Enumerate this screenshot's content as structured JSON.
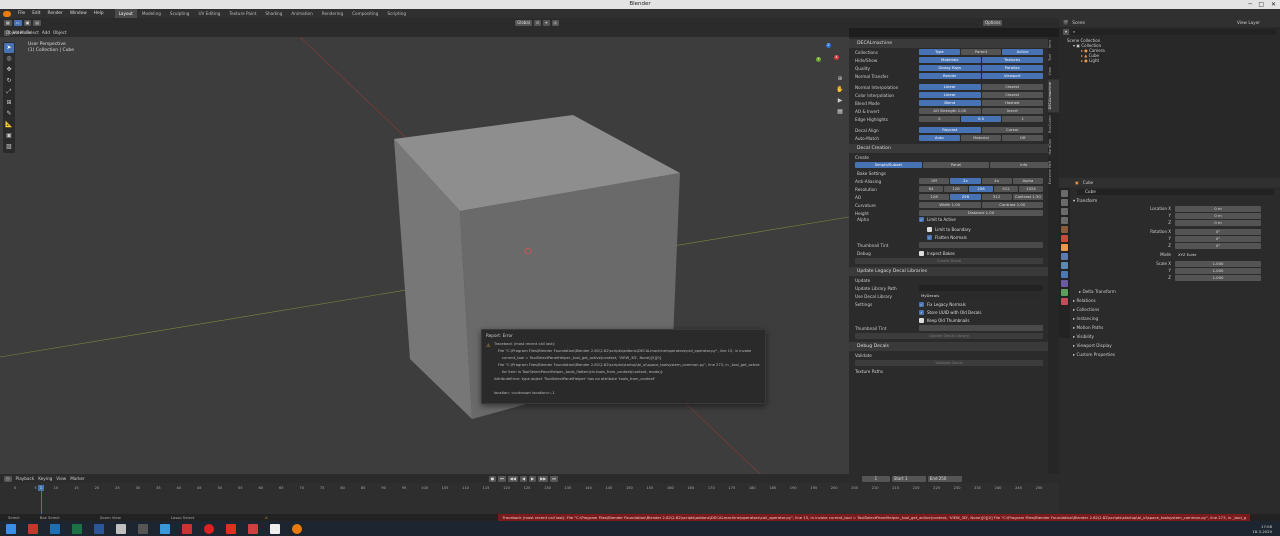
{
  "window": {
    "title": "Blender",
    "minimize": "─",
    "maximize": "□",
    "close": "✕"
  },
  "menu": {
    "items": [
      "File",
      "Edit",
      "Render",
      "Window",
      "Help"
    ],
    "workspaces": [
      "Layout",
      "Modeling",
      "Sculpting",
      "UV Editing",
      "Texture Paint",
      "Shading",
      "Animation",
      "Rendering",
      "Compositing",
      "Scripting"
    ],
    "active_workspace": "Layout"
  },
  "viewport": {
    "mode": "Object Mode",
    "menus": [
      "View",
      "Select",
      "Add",
      "Object"
    ],
    "orientation": "Global",
    "options": "Options",
    "overlay_title": "User Perspective",
    "overlay_sub": "(1) Collection | Cube",
    "gizmo_x": "X",
    "gizmo_y": "Y",
    "gizmo_z": "Z"
  },
  "npanel": {
    "header": "DECALmachine",
    "rows1": [
      {
        "label": "Collections",
        "buttons": [
          "Type",
          "Parent",
          "Active"
        ],
        "on": [
          0,
          2
        ]
      },
      {
        "label": "Hide/Show",
        "buttons": [
          "Materials",
          "Textures"
        ],
        "on": [
          0,
          1
        ]
      },
      {
        "label": "Quality",
        "buttons": [
          "Glossy Rays",
          "Parallax"
        ],
        "on": [
          0,
          1
        ]
      },
      {
        "label": "Normal Transfer",
        "buttons": [
          "Render",
          "Viewport"
        ],
        "on": [
          0,
          1
        ]
      }
    ],
    "rows2": [
      {
        "label": "Normal Interpolation",
        "buttons": [
          "Linear",
          "Closest"
        ],
        "on": [
          0
        ]
      },
      {
        "label": "Color Interpolation",
        "buttons": [
          "Linear",
          "Closest"
        ],
        "on": [
          0
        ]
      },
      {
        "label": "Blend Mode",
        "buttons": [
          "Blend",
          "Hashed"
        ],
        "on": [
          0
        ]
      },
      {
        "label": "AO & Invert",
        "buttons": [
          "AO Strength  1.00",
          "Invert"
        ],
        "on": []
      },
      {
        "label": "Edge Highlights",
        "buttons": [
          "0",
          "0.5",
          "1"
        ],
        "on": [
          1
        ]
      }
    ],
    "rows3": [
      {
        "label": "Decal Align",
        "buttons": [
          "Raycast",
          "Cursor"
        ],
        "on": [
          0
        ]
      },
      {
        "label": "Auto-Match",
        "buttons": [
          "Auto",
          "Material",
          "Off"
        ],
        "on": [
          0
        ]
      }
    ],
    "decal_creation": {
      "header": "Decal Creation",
      "create_label": "Create",
      "create_buttons": [
        "Simple/Subset",
        "Panel",
        "Info"
      ],
      "bake_settings": "Bake Settings",
      "rows": [
        {
          "label": "Anti-Aliasing",
          "buttons": [
            "Off",
            "2x",
            "4x",
            "Alpha"
          ],
          "on": [
            1
          ]
        },
        {
          "label": "Resolution",
          "buttons": [
            "64",
            "128",
            "256",
            "512",
            "1024"
          ],
          "on": [
            2
          ]
        },
        {
          "label": "AO",
          "buttons": [
            "128",
            "256",
            "512",
            "Contrast   1.50"
          ],
          "on": [
            1
          ]
        },
        {
          "label": "Curvature",
          "buttons": [
            "Width   1.00",
            "Contrast   1.00"
          ],
          "on": []
        },
        {
          "label": "Height",
          "buttons": [
            "Distance   1.00"
          ],
          "on": []
        }
      ],
      "alpha_label": "Alpha",
      "alpha_opts": [
        "Limit to Active",
        "Limit to Boundary",
        "Flatten Normals"
      ],
      "thumb_label": "Thumbnail Tint",
      "debug_label": "Debug",
      "debug_opt": "Inspect Bakes",
      "create_decal": "Create Decal"
    },
    "legacy": {
      "header": "Update Legacy Decal Libraries",
      "update": "Update",
      "path_label": "Update Library Path",
      "use_lib_label": "Use Decal Library",
      "use_lib_val": "MyDecals",
      "settings": "Settings",
      "opts": [
        "Fix Legacy Normals",
        "Store UUID with Old Decals",
        "Keep Old Thumbnails"
      ],
      "thumb": "Thumbnail Tint",
      "btn": "Update Decal Library"
    },
    "debug": {
      "header": "Debug Decals",
      "validate": "Validate",
      "btn": "Validate Decal",
      "paths": "Texture Paths"
    },
    "tabs": [
      "Item",
      "Tool",
      "View",
      "DECALmachine",
      "BoxCutter",
      "HardOps",
      "Extreme PBR"
    ]
  },
  "outliner": {
    "scene": "Scene",
    "view_layer": "View Layer",
    "root": "Scene Collection",
    "items": [
      "Collection",
      "Camera",
      "Cube",
      "Light"
    ]
  },
  "properties": {
    "object": "Cube",
    "name": "Cube",
    "transform": "Transform",
    "fields": [
      {
        "label": "Location X",
        "value": "0 m"
      },
      {
        "label": "Y",
        "value": "0 m"
      },
      {
        "label": "Z",
        "value": "0 m"
      },
      {
        "label": "Rotation X",
        "value": "0°"
      },
      {
        "label": "Y",
        "value": "0°"
      },
      {
        "label": "Z",
        "value": "0°"
      },
      {
        "label": "Mode",
        "value": "XYZ Euler"
      },
      {
        "label": "Scale X",
        "value": "1.000"
      },
      {
        "label": "Y",
        "value": "1.000"
      },
      {
        "label": "Z",
        "value": "1.000"
      }
    ],
    "sections": [
      "Delta Transform",
      "Relations",
      "Collections",
      "Instancing",
      "Motion Paths",
      "Visibility",
      "Viewport Display",
      "Custom Properties"
    ]
  },
  "timeline": {
    "menus": [
      "Playback",
      "Keying",
      "View",
      "Marker"
    ],
    "current_frame": "1",
    "start_label": "Start",
    "start": "1",
    "end_label": "End",
    "end": "250",
    "ticks": [
      "0",
      "5",
      "10",
      "15",
      "20",
      "25",
      "30",
      "35",
      "40",
      "45",
      "50",
      "55",
      "60",
      "65",
      "70",
      "75",
      "80",
      "85",
      "90",
      "95",
      "100",
      "105",
      "110",
      "115",
      "120",
      "125",
      "130",
      "135",
      "140",
      "145",
      "150",
      "155",
      "160",
      "165",
      "170",
      "175",
      "180",
      "185",
      "190",
      "195",
      "200",
      "205",
      "210",
      "215",
      "220",
      "225",
      "230",
      "235",
      "240",
      "245",
      "250"
    ]
  },
  "status": {
    "left": [
      "Select",
      "Box Select",
      "Zoom View",
      "Lasso Select"
    ],
    "error": "Traceback (most recent call last): File \"C:\\Program Files\\Blender Foundation\\Blender 2.82\\2.82\\scripts\\addons\\DECALmachine\\operators\\call_operator.py\", line 15, in invoke    current_tool = ToolSelectPanelHelper._tool_get_active(context, 'VIEW_3D', None)[0][0]  File \"C:\\Program Files\\Blender Foundation\\Blender 2.82\\2.82\\scripts\\startup\\bl_ui\\space_toolsystem_common.py\", line 273, in _tool_g"
  },
  "error": {
    "title": "Report: Error",
    "lines": [
      "Traceback (most recent call last):",
      "File \"C:\\Program Files\\Blender Foundation\\Blender 2.82\\2.82\\scripts\\addons\\DECALmachine\\operators\\call_operator.py\", line 15, in invoke",
      "current_tool = ToolSelectPanelHelper._tool_get_active(context, 'VIEW_3D', None)[0][0]",
      "File \"C:\\Program Files\\Blender Foundation\\Blender 2.82\\2.82\\scripts\\startup\\bl_ui\\space_toolsystem_common.py\", line 273, in _tool_get_active",
      "for item in ToolSelectPanelHelper._tools_flatten(cls.tools_from_context(context, mode)):",
      "AttributeError: type object 'ToolSelectPanelHelper' has no attribute 'tools_from_context'",
      "",
      "location: <unknown location>:-1"
    ]
  },
  "taskbar": {
    "time": "17:08",
    "date": "18-3-2020"
  }
}
